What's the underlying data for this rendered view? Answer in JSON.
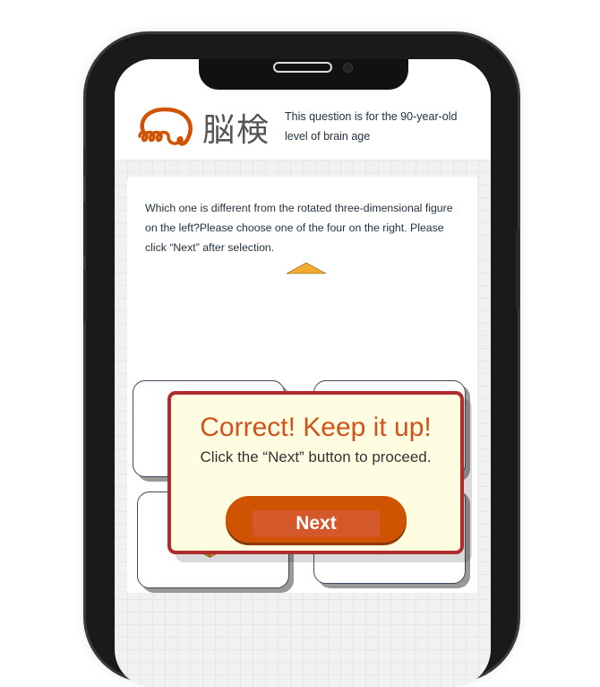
{
  "header": {
    "logo_text": "脳検",
    "age_note": "This question is for the 90-year-old level of brain age"
  },
  "question": {
    "text": "Which one is different from the rotated three-dimensional figure on the left?Please choose one of the four on the right. Please click “Next” after selection."
  },
  "popup": {
    "title": "Correct! Keep it up!",
    "message": "Click the “Next” button to proceed.",
    "next_label": "Next"
  },
  "colors": {
    "accent": "#cf5300",
    "popup_border": "#b02c2c",
    "popup_bg": "#fffde1",
    "title": "#d0521c",
    "cube": "#f2aa2e"
  },
  "options": [
    {
      "id": "top-left"
    },
    {
      "id": "top-right"
    },
    {
      "id": "bottom-left"
    },
    {
      "id": "bottom-right"
    }
  ]
}
